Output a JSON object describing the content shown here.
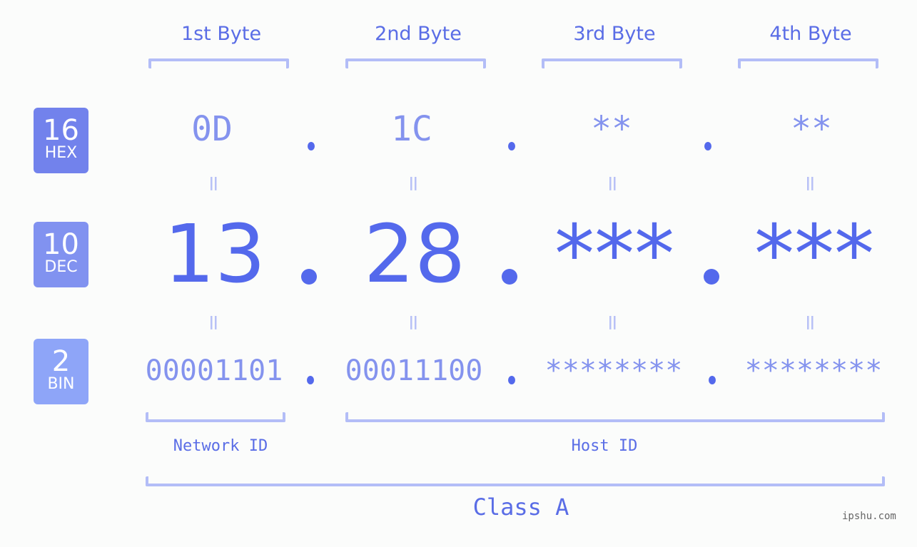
{
  "bytes": [
    {
      "title": "1st Byte",
      "hex": "0D",
      "dec": "13",
      "bin": "00001101"
    },
    {
      "title": "2nd Byte",
      "hex": "1C",
      "dec": "28",
      "bin": "00011100"
    },
    {
      "title": "3rd Byte",
      "hex": "**",
      "dec": "***",
      "bin": "********"
    },
    {
      "title": "4th Byte",
      "hex": "**",
      "dec": "***",
      "bin": "********"
    }
  ],
  "badges": {
    "hex": {
      "num": "16",
      "label": "HEX",
      "color": "#7282ec"
    },
    "dec": {
      "num": "10",
      "label": "DEC",
      "color": "#8192f0"
    },
    "bin": {
      "num": "2",
      "label": "BIN",
      "color": "#8ea5f8"
    }
  },
  "equals_symbol": "=",
  "labels": {
    "network_id": "Network ID",
    "host_id": "Host ID",
    "class": "Class A"
  },
  "watermark": "ipshu.com",
  "colors": {
    "accent": "#5469ec",
    "light": "#8493ee",
    "bracket": "#b3bdf7"
  }
}
